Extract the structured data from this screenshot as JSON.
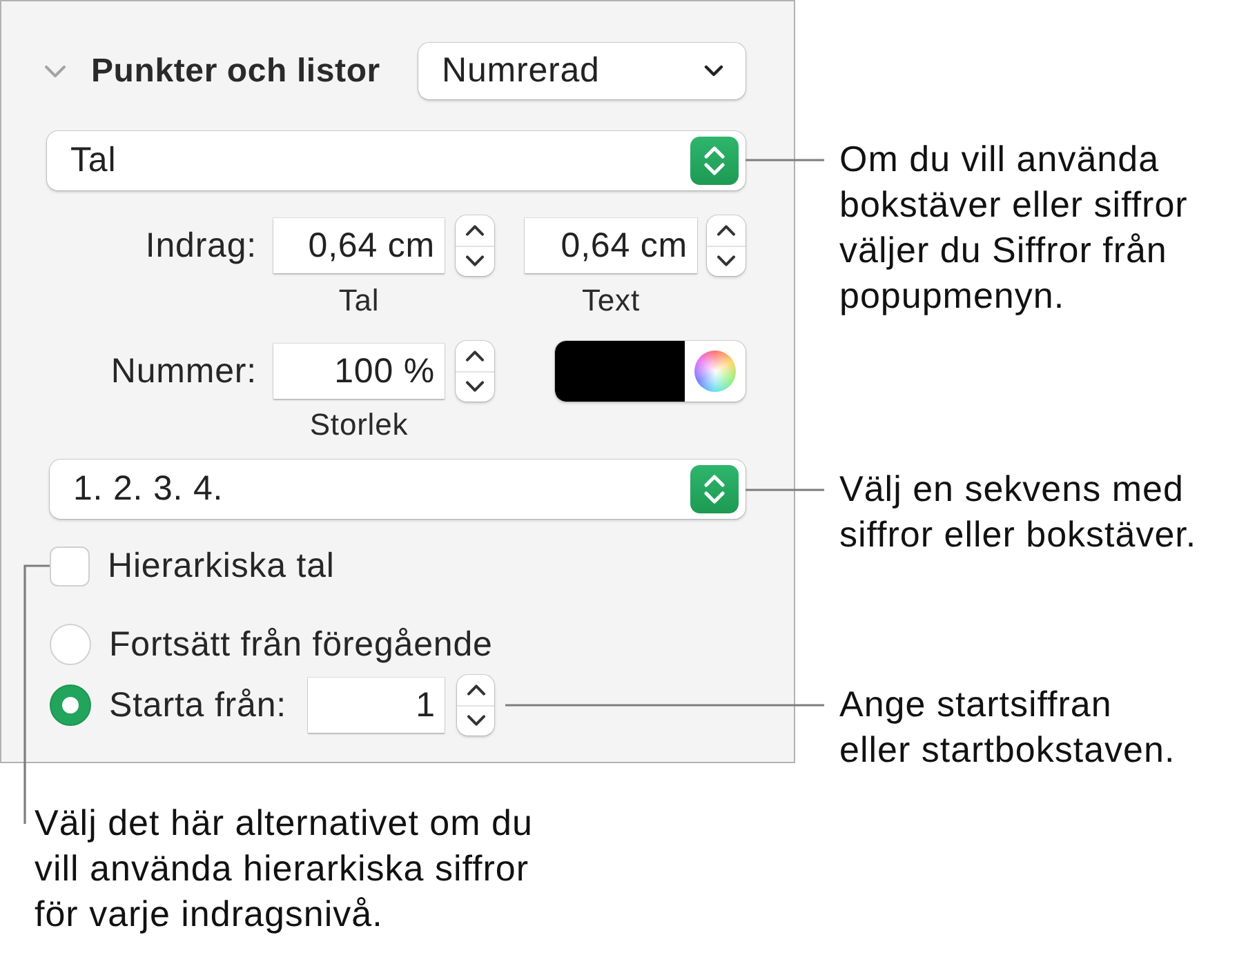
{
  "panel": {
    "section": {
      "title": "Punkter och listor",
      "expanded": true
    },
    "list_style_popup": {
      "value": "Numrerad"
    },
    "bullet_type_popup": {
      "value": "Tal"
    },
    "indent": {
      "label": "Indrag:",
      "fields": [
        {
          "value": "0,64 cm",
          "caption": "Tal"
        },
        {
          "value": "0,64 cm",
          "caption": "Text"
        }
      ]
    },
    "number_size": {
      "label": "Nummer:",
      "value": "100 %",
      "caption": "Storlek"
    },
    "color_well": {
      "color": "#000000"
    },
    "sequence_popup": {
      "value": "1. 2. 3. 4."
    },
    "hierarchical": {
      "label": "Hierarkiska tal",
      "checked": false
    },
    "numbering": [
      {
        "kind": "radio",
        "label": "Fortsätt från föregående",
        "selected": false
      },
      {
        "kind": "radio_field",
        "label": "Starta från:",
        "selected": true,
        "value": "1"
      }
    ]
  },
  "callouts": [
    {
      "text": "Om du vill använda\nbokstäver eller siffror\nväljer du Siffror från\npopupmenyn."
    },
    {
      "text": "Välj en sekvens med\nsiffror eller bokstäver."
    },
    {
      "text": "Ange startsiffran\neller startbokstaven."
    }
  ],
  "bottom_callout": {
    "text": "Välj det här alternativet om du\nvill använda hierarkiska siffror\nför varje indragsnivå."
  }
}
